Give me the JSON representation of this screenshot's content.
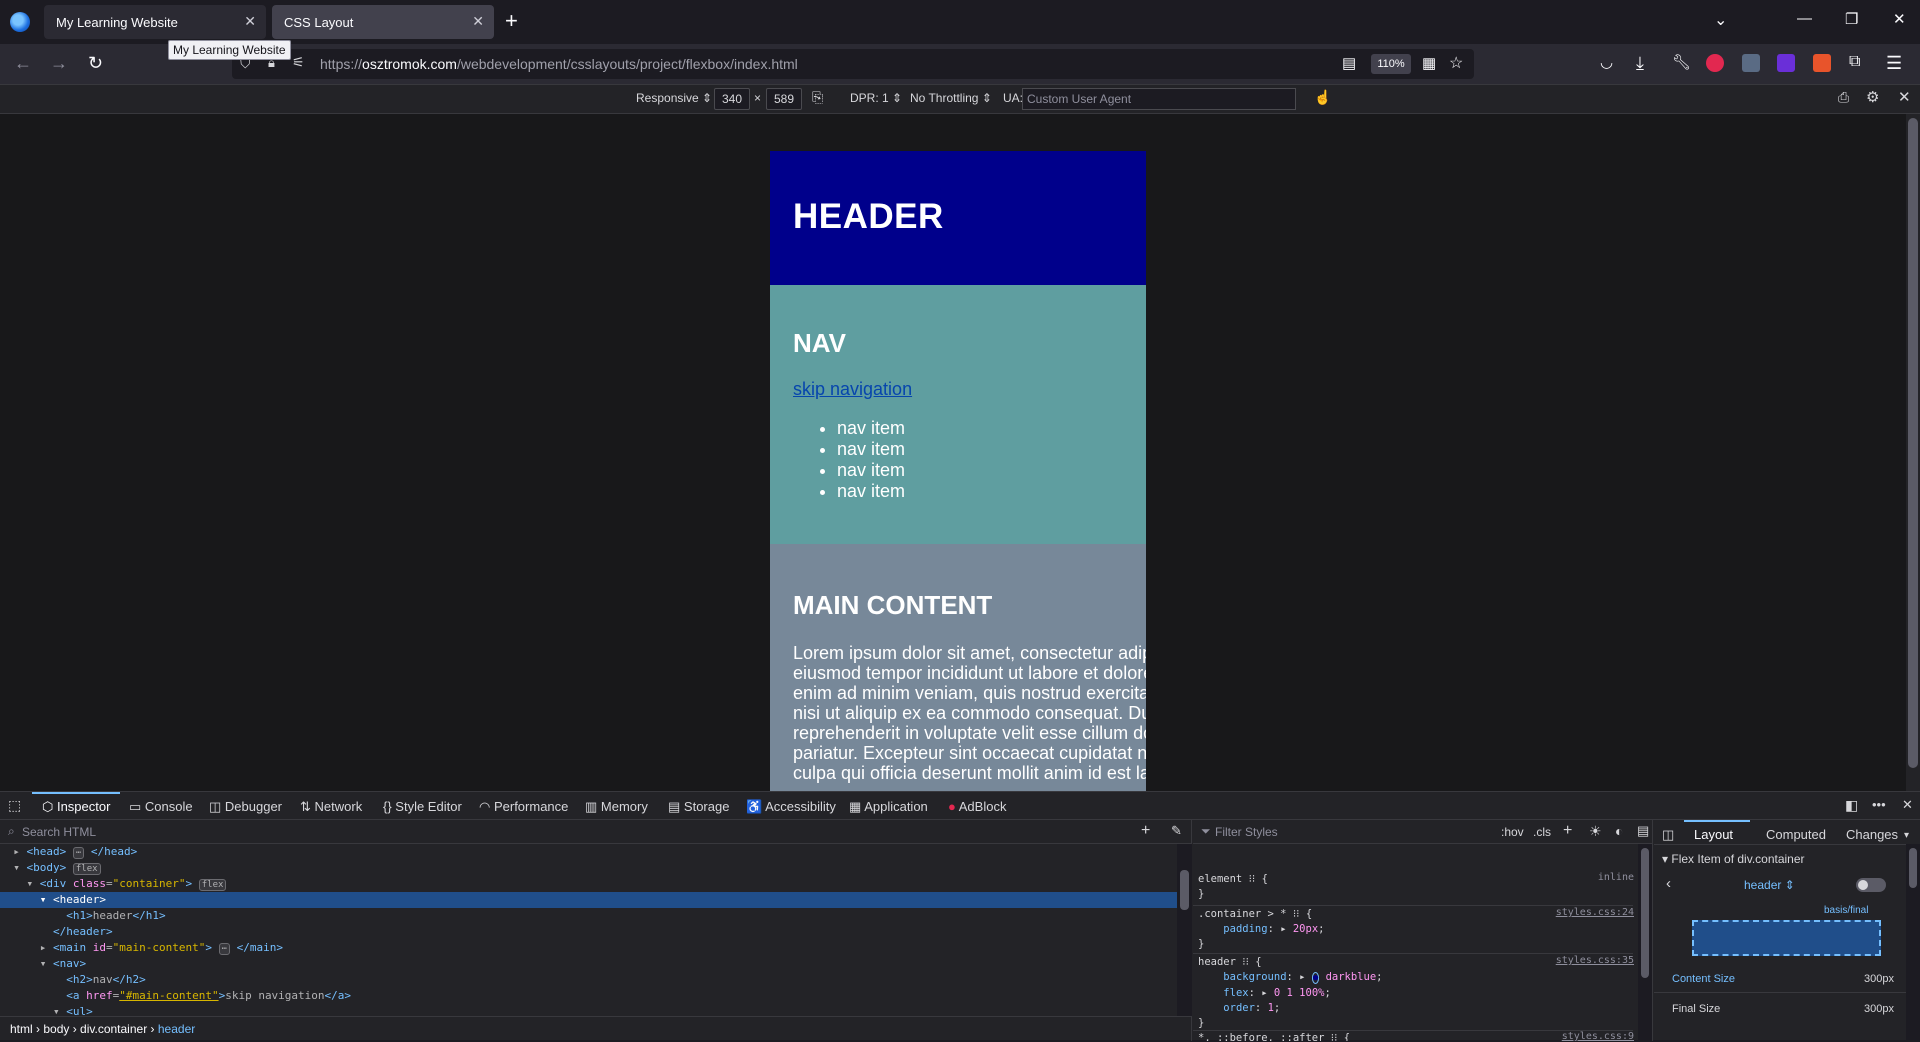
{
  "browser": {
    "tabs": [
      {
        "title": "My Learning Website"
      },
      {
        "title": "CSS Layout"
      }
    ],
    "tooltip": "My Learning Website",
    "url_prefix": "https://",
    "url_domain": "osztromok.com",
    "url_path": "/webdevelopment/csslayouts/project/flexbox/index.html",
    "zoom": "110%"
  },
  "rdm": {
    "device": "Responsive",
    "width": "340",
    "times": "×",
    "height": "589",
    "dpr": "DPR: 1",
    "throttling": "No Throttling",
    "ua_label": "UA:",
    "ua_placeholder": "Custom User Agent"
  },
  "sim_page": {
    "header_title": "HEADER",
    "nav_title": "NAV",
    "skip_link": "skip navigation",
    "nav_items": [
      "nav item",
      "nav item",
      "nav item",
      "nav item"
    ],
    "main_title": "MAIN CONTENT",
    "main_text": "Lorem ipsum dolor sit amet, consectetur adip\neiusmod tempor incididunt ut labore et dolore\nenim ad minim veniam, quis nostrud exercitat\nnisi ut aliquip ex ea commodo consequat. Du\nreprehenderit in voluptate velit esse cillum do\npariatur. Excepteur sint occaecat cupidatat no\nculpa qui officia deserunt mollit anim id est lal"
  },
  "devtools": {
    "tabs": [
      "Inspector",
      "Console",
      "Debugger",
      "Network",
      "Style Editor",
      "Performance",
      "Memory",
      "Storage",
      "Accessibility",
      "Application",
      "AdBlock"
    ],
    "search_placeholder": "Search HTML",
    "breadcrumb": [
      "html",
      "body",
      "div.container",
      "header"
    ],
    "filter_placeholder": "Filter Styles",
    "hov": ":hov",
    "cls": ".cls",
    "layout_tabs": [
      "Layout",
      "Computed",
      "Changes"
    ],
    "flex_item_title": "Flex Item of div.container",
    "flex_item_select": "header",
    "basis_final": "basis/final",
    "content_size_label": "Content Size",
    "content_size_value": "300px",
    "final_size_label": "Final Size",
    "final_size_value": "300px"
  }
}
